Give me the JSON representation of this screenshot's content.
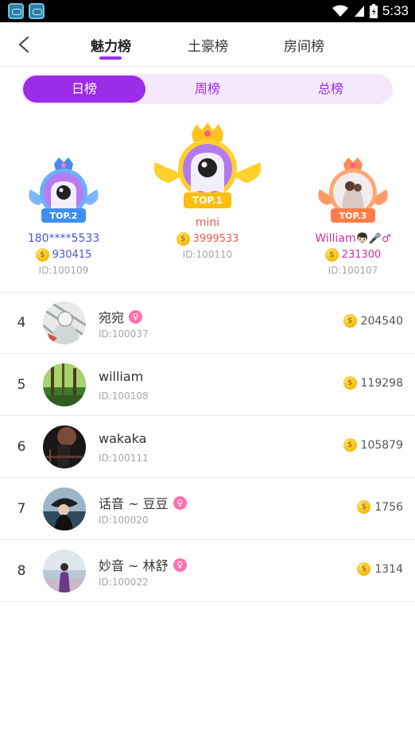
{
  "status_bar": {
    "time": "5:33"
  },
  "header": {
    "tabs": [
      {
        "label": "魅力榜",
        "active": true
      },
      {
        "label": "土豪榜",
        "active": false
      },
      {
        "label": "房间榜",
        "active": false
      }
    ]
  },
  "period": {
    "items": [
      {
        "label": "日榜",
        "active": true
      },
      {
        "label": "周榜",
        "active": false
      },
      {
        "label": "总榜",
        "active": false
      }
    ]
  },
  "podium": {
    "first": {
      "badge": "TOP.1",
      "name": "mini",
      "coins": "3999533",
      "id": "ID:100110",
      "color": "#f05a4f"
    },
    "second": {
      "badge": "TOP.2",
      "name": "180****5533",
      "coins": "930415",
      "id": "ID:100109",
      "color": "#4b56d6"
    },
    "third": {
      "badge": "TOP.3",
      "name": "William",
      "name_emoji": "👦🏻🎤♂",
      "coins": "231300",
      "id": "ID:100107",
      "color": "#d02e9a"
    }
  },
  "list": [
    {
      "rank": "4",
      "name": "宛宛",
      "female": true,
      "id": "ID:100037",
      "coins": "204540",
      "avatar": "sketch"
    },
    {
      "rank": "5",
      "name": "william",
      "female": false,
      "id": "ID:100108",
      "coins": "119298",
      "avatar": "forest"
    },
    {
      "rank": "6",
      "name": "wakaka",
      "female": false,
      "id": "ID:100111",
      "coins": "105879",
      "avatar": "night"
    },
    {
      "rank": "7",
      "name": "话音 ~ 豆豆",
      "female": true,
      "id": "ID:100020",
      "coins": "1756",
      "avatar": "portrait"
    },
    {
      "rank": "8",
      "name": "妙音 ~ 林舒",
      "female": true,
      "id": "ID:100022",
      "coins": "1314",
      "avatar": "beach"
    }
  ],
  "colors": {
    "accent": "#9b2ce8",
    "accent_light": "#f4e8fc",
    "id_gray": "#a6a6a6"
  }
}
